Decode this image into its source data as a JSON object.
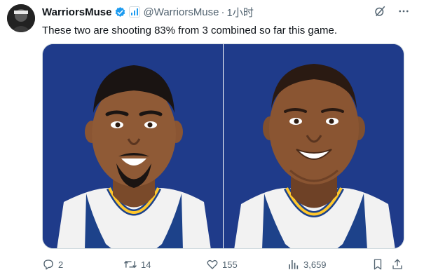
{
  "tweet": {
    "author_name": "WarriorsMuse",
    "handle": "@WarriorsMuse",
    "separator": "·",
    "time": "1小时",
    "text": "These two are shooting 83% from 3 combined so far this game."
  },
  "stats": {
    "replies": "2",
    "retweets": "14",
    "likes": "155",
    "views": "3,659"
  },
  "icons": {
    "verified": "verified-badge-icon",
    "affiliate": "affiliate-badge-icon",
    "grok": "grok-icon",
    "more": "more-icon",
    "reply": "reply-icon",
    "retweet": "retweet-icon",
    "like": "heart-icon",
    "views": "views-icon",
    "bookmark": "bookmark-icon",
    "share": "share-icon"
  },
  "colors": {
    "verified": "#1d9bf0",
    "panel_bg": "#1f3b8a",
    "jersey_blue": "#1d428a",
    "jersey_gold": "#ffc72c",
    "text_secondary": "#536471"
  }
}
